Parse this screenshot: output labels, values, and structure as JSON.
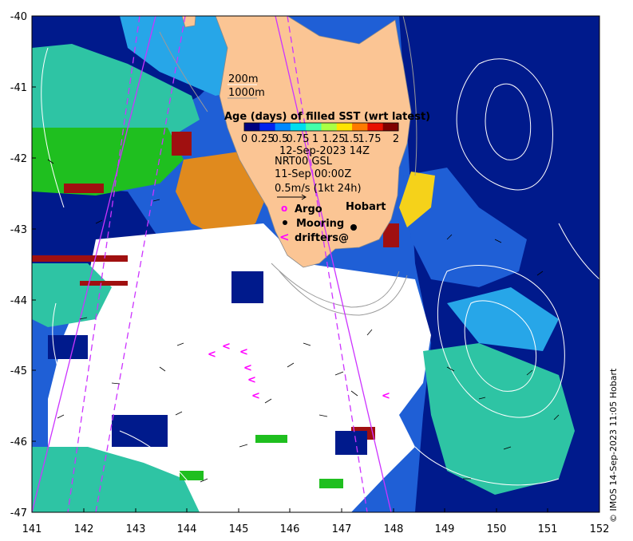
{
  "map": {
    "lon_range": [
      141,
      152
    ],
    "lat_range": [
      -47,
      -40
    ],
    "x_ticks": [
      "141",
      "142",
      "143",
      "144",
      "145",
      "146",
      "147",
      "148",
      "149",
      "150",
      "151",
      "152"
    ],
    "y_ticks": [
      "-40",
      "-41",
      "-42",
      "-43",
      "-44",
      "-45",
      "-46",
      "-47"
    ],
    "colors": {
      "ocean_deep": "#001a8c",
      "ocean_blue": "#1f5fd6",
      "ocean_light": "#27a6e8",
      "teal": "#2ec4a4",
      "green": "#1fbf1f",
      "orange": "#e08a1e",
      "darkred": "#a01010",
      "land": "#fbc594",
      "track": "#cc33ff"
    }
  },
  "legend": {
    "contour_200": "200m",
    "contour_1000": "1000m",
    "colorbar_title": "Age (days) of filled SST (wrt latest)",
    "colorbar_ticks": [
      "0",
      "0.25",
      "0.5",
      "0.75",
      "1",
      "1.25",
      "1.5",
      "1.75",
      "2"
    ],
    "colorbar_colors": [
      "#00007f",
      "#0022ee",
      "#0088ff",
      "#00ddee",
      "#44ffaa",
      "#aaff44",
      "#ffe400",
      "#ff7a00",
      "#e81000",
      "#7f0000"
    ],
    "date": "12-Sep-2023 14Z",
    "product": "NRT00 GSL",
    "product_date": "11-Sep 00:00Z",
    "scale_label": "0.5m/s (1kt 24h)",
    "argo_label": "Argo",
    "mooring_label": "Mooring",
    "drifters_label": "drifters@",
    "argo_symbol": "o",
    "drifter_symbol": "<"
  },
  "places": {
    "hobart": "Hobart"
  },
  "credit": "© IMOS 14-Sep-2023 11:05 Hobart"
}
